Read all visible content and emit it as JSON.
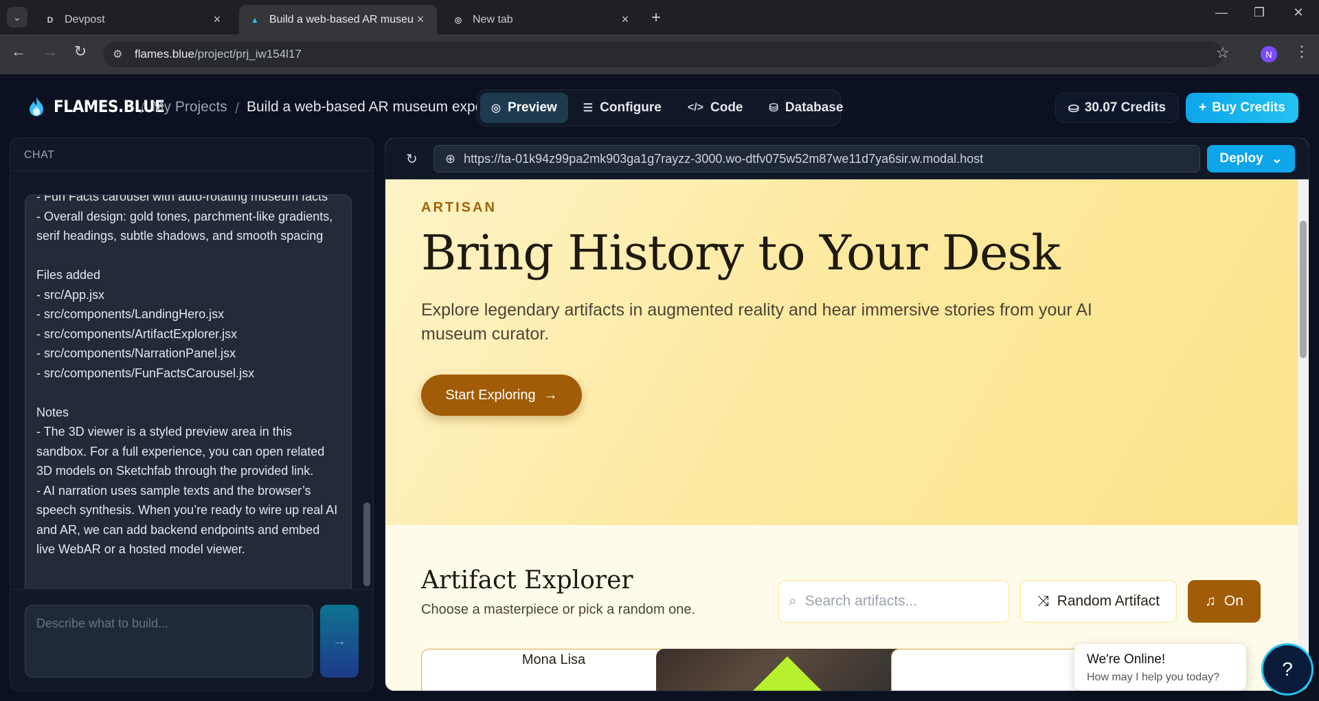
{
  "browser": {
    "tabs": [
      {
        "label": "Devpost",
        "favicon": "D"
      },
      {
        "label": "Build a web-based AR museum",
        "favicon": "flame"
      },
      {
        "label": "New tab",
        "favicon": "chrome"
      }
    ],
    "url_host": "flames.blue",
    "url_path": "/project/prj_iw154l17",
    "profile_initial": "N"
  },
  "app": {
    "brand": "FLAMES.BLUE",
    "breadcrumb": {
      "projects": "My Projects",
      "current": "Build a web-based AR museum experience"
    },
    "nav": {
      "preview": "Preview",
      "configure": "Configure",
      "code": "Code",
      "database": "Database"
    },
    "credits": "30.07 Credits",
    "buy": "Buy Credits",
    "colors": {
      "accent": "#0ea5e9",
      "bg": "#0b1120",
      "gold": "#a15c07"
    }
  },
  "chat": {
    "header": "CHAT",
    "message": "- Fun Facts carousel with auto-rotating museum facts\n- Overall design: gold tones, parchment-like gradients, serif headings, subtle shadows, and smooth spacing\n\nFiles added\n- src/App.jsx\n- src/components/LandingHero.jsx\n- src/components/ArtifactExplorer.jsx\n- src/components/NarrationPanel.jsx\n- src/components/FunFactsCarousel.jsx\n\nNotes\n- The 3D viewer is a styled preview area in this sandbox. For a full experience, you can open related 3D models on Sketchfab through the provided link.\n- AI narration uses sample texts and the browser’s speech synthesis. When you’re ready to wire up real AI and AR, we can add backend endpoints and embed live WebAR or a hosted model viewer.",
    "input_placeholder": "Describe what to build...",
    "send": "→"
  },
  "preview": {
    "url": "https://ta-01k94z99pa2mk903ga1g7rayzz-3000.wo-dtfv075w52m87we11d7ya6sir.w.modal.host",
    "deploy": "Deploy",
    "hero": {
      "eyebrow": "ARTISAN",
      "title": "Bring History to Your Desk",
      "lede": "Explore legendary artifacts in augmented reality and hear immersive stories from your AI museum curator.",
      "cta": "Start Exploring"
    },
    "explorer": {
      "title": "Artifact Explorer",
      "subtitle": "Choose a masterpiece or pick a random one.",
      "search_placeholder": "Search artifacts...",
      "random": "Random Artifact",
      "music": "On",
      "cards": [
        "Mona Lisa"
      ]
    }
  },
  "support": {
    "title": "We're Online!",
    "subtitle": "How may I help you today?"
  }
}
